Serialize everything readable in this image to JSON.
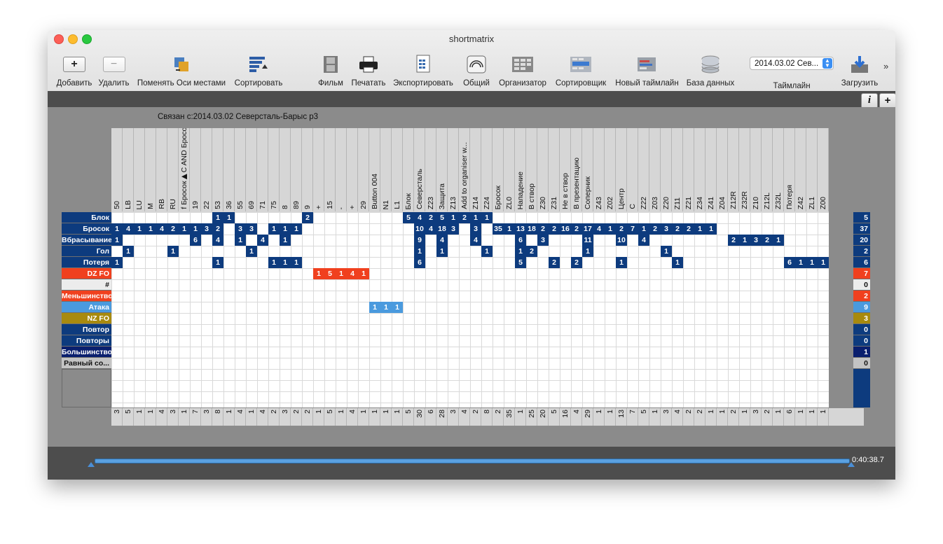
{
  "window": {
    "title": "shortmatrix"
  },
  "toolbar": {
    "add": "Добавить",
    "delete": "Удалить",
    "swap_axes": "Поменять Оси местами",
    "sort": "Сортировать",
    "film": "Фильм",
    "print": "Печатать",
    "export": "Экспортировать",
    "share": "Общий",
    "organizer": "Организатор",
    "sorter": "Сортировщик",
    "new_timeline": "Новый таймлайн",
    "database": "База данных",
    "timeline_label": "Таймлайн",
    "timeline_value": "2014.03.02 Сев...",
    "load": "Загрузить",
    "more": "»",
    "info_btn": "i",
    "plus_btn": "+"
  },
  "linked_label": "Связан с:2014.03.02 Северсталь-Барыс р3",
  "columns": [
    "50",
    "LB",
    "LU",
    "M",
    "RB",
    "RU",
    "f Бросок▶C AND Бросок",
    "19",
    "22",
    "53",
    "36",
    "55",
    "69",
    "71",
    "75",
    "8",
    "89",
    "9",
    "+",
    "15",
    "-",
    "+",
    "29",
    "Button 004",
    "N1",
    "L1",
    "Блок",
    "Северсталь",
    "Z23",
    "Защита",
    "Z13",
    "Add to organiser w...",
    "Z14",
    "Z24",
    "Бросок",
    "ZL0",
    "Нападение",
    "В створ",
    "Z30",
    "Z31",
    "Не в створ",
    "В презентацию",
    "Соперник",
    "Z43",
    "Z02",
    "Центр",
    "C",
    "Z22",
    "Z03",
    "Z20",
    "Z11",
    "Z21",
    "Z34",
    "Z41",
    "Z04",
    "Z12R",
    "Z32R",
    "Z10",
    "Z12L",
    "Z32L",
    "Потеря",
    "Z42",
    "ZL1",
    "Z00"
  ],
  "column_totals": [
    "3",
    "5",
    "1",
    "1",
    "4",
    "3",
    "1",
    "7",
    "3",
    "8",
    "1",
    "4",
    "1",
    "4",
    "2",
    "3",
    "2",
    "2",
    "1",
    "5",
    "1",
    "4",
    "1",
    "1",
    "1",
    "1",
    "5",
    "30",
    "6",
    "28",
    "3",
    "4",
    "2",
    "8",
    "2",
    "35",
    "1",
    "25",
    "20",
    "5",
    "16",
    "4",
    "29",
    "1",
    "1",
    "13",
    "7",
    "5",
    "1",
    "3",
    "4",
    "2",
    "2",
    "1",
    "1",
    "2",
    "1",
    "3",
    "2",
    "1",
    "6",
    "1",
    "1",
    "1"
  ],
  "rows": [
    {
      "label": "Блок",
      "color": "#0d3b7e",
      "total": "5",
      "total_color": "#0d3b7e",
      "cells": [
        [
          9,
          "1"
        ],
        [
          10,
          "1"
        ],
        [
          17,
          "2"
        ],
        [
          26,
          "5"
        ],
        [
          27,
          "4"
        ],
        [
          28,
          "2"
        ],
        [
          29,
          "5"
        ],
        [
          30,
          "1"
        ],
        [
          31,
          "2"
        ],
        [
          32,
          "1"
        ],
        [
          33,
          "1"
        ]
      ]
    },
    {
      "label": "Бросок",
      "color": "#0d3b7e",
      "total": "37",
      "total_color": "#0d3b7e",
      "cells": [
        [
          0,
          "1"
        ],
        [
          1,
          "4"
        ],
        [
          2,
          "1"
        ],
        [
          3,
          "1"
        ],
        [
          4,
          "4"
        ],
        [
          5,
          "2"
        ],
        [
          6,
          "1"
        ],
        [
          7,
          "1"
        ],
        [
          8,
          "3"
        ],
        [
          9,
          "2"
        ],
        [
          11,
          "3"
        ],
        [
          12,
          "3"
        ],
        [
          14,
          "1"
        ],
        [
          15,
          "1"
        ],
        [
          16,
          "1"
        ],
        [
          27,
          "10"
        ],
        [
          28,
          "4"
        ],
        [
          29,
          "18"
        ],
        [
          30,
          "3"
        ],
        [
          32,
          "3"
        ],
        [
          34,
          "35"
        ],
        [
          35,
          "1"
        ],
        [
          36,
          "13"
        ],
        [
          37,
          "18"
        ],
        [
          38,
          "2"
        ],
        [
          39,
          "2"
        ],
        [
          40,
          "16"
        ],
        [
          41,
          "2"
        ],
        [
          42,
          "17"
        ],
        [
          43,
          "4"
        ],
        [
          44,
          "1"
        ],
        [
          45,
          "2"
        ],
        [
          46,
          "7"
        ],
        [
          47,
          "1"
        ],
        [
          48,
          "2"
        ],
        [
          49,
          "3"
        ],
        [
          50,
          "2"
        ],
        [
          51,
          "2"
        ],
        [
          52,
          "1"
        ],
        [
          53,
          "1"
        ]
      ]
    },
    {
      "label": "Вбрасывание",
      "color": "#0d3b7e",
      "total": "20",
      "total_color": "#0d3b7e",
      "cells": [
        [
          0,
          "1"
        ],
        [
          7,
          "6"
        ],
        [
          9,
          "4"
        ],
        [
          11,
          "1"
        ],
        [
          13,
          "4"
        ],
        [
          15,
          "1"
        ],
        [
          27,
          "9"
        ],
        [
          29,
          "4"
        ],
        [
          32,
          "4"
        ],
        [
          36,
          "6"
        ],
        [
          38,
          "3"
        ],
        [
          42,
          "11"
        ],
        [
          45,
          "10"
        ],
        [
          47,
          "4"
        ],
        [
          55,
          "2"
        ],
        [
          56,
          "1"
        ],
        [
          57,
          "3"
        ],
        [
          58,
          "2"
        ],
        [
          59,
          "1"
        ]
      ]
    },
    {
      "label": "Гол",
      "color": "#0d3b7e",
      "total": "2",
      "total_color": "#0d3b7e",
      "cells": [
        [
          1,
          "1"
        ],
        [
          5,
          "1"
        ],
        [
          12,
          "1"
        ],
        [
          27,
          "1"
        ],
        [
          29,
          "1"
        ],
        [
          33,
          "1"
        ],
        [
          36,
          "1"
        ],
        [
          37,
          "2"
        ],
        [
          42,
          "1"
        ],
        [
          49,
          "1"
        ]
      ]
    },
    {
      "label": "Потеря",
      "color": "#0d3b7e",
      "total": "6",
      "total_color": "#0d3b7e",
      "cells": [
        [
          0,
          "1"
        ],
        [
          9,
          "1"
        ],
        [
          14,
          "1"
        ],
        [
          15,
          "1"
        ],
        [
          16,
          "1"
        ],
        [
          27,
          "6"
        ],
        [
          36,
          "5"
        ],
        [
          39,
          "2"
        ],
        [
          41,
          "2"
        ],
        [
          45,
          "1"
        ],
        [
          50,
          "1"
        ],
        [
          60,
          "6"
        ],
        [
          61,
          "1"
        ],
        [
          62,
          "1"
        ],
        [
          63,
          "1"
        ]
      ]
    },
    {
      "label": "DZ FO",
      "color": "#f0401e",
      "total": "7",
      "total_color": "#f0401e",
      "cells": [
        [
          18,
          "1"
        ],
        [
          19,
          "5"
        ],
        [
          20,
          "1"
        ],
        [
          21,
          "4"
        ],
        [
          22,
          "1"
        ]
      ]
    },
    {
      "label": "#",
      "color": "#ececec",
      "text_color": "#111111",
      "total": "0",
      "total_color": "#ececec",
      "cells": []
    },
    {
      "label": "Меньшинство",
      "color": "#f0401e",
      "total": "2",
      "total_color": "#f0401e",
      "cells": []
    },
    {
      "label": "Атака",
      "color": "#4a9ade",
      "total": "9",
      "total_color": "#4a9ade",
      "cells": [
        [
          23,
          "1"
        ],
        [
          24,
          "1"
        ],
        [
          25,
          "1"
        ]
      ]
    },
    {
      "label": "NZ FO",
      "color": "#a88a0e",
      "total": "3",
      "total_color": "#a88a0e",
      "cells": []
    },
    {
      "label": "Повтор",
      "color": "#0d3b7e",
      "total": "0",
      "total_color": "#0d3b7e",
      "cells": []
    },
    {
      "label": "Повторы",
      "color": "#0d3b7e",
      "total": "0",
      "total_color": "#0d3b7e",
      "cells": []
    },
    {
      "label": "Большинство",
      "color": "#0a1f6e",
      "total": "1",
      "total_color": "#0a1f6e",
      "cells": []
    },
    {
      "label": "Равный со...",
      "color": "#c4c4c4",
      "text_color": "#111111",
      "total": "0",
      "total_color": "#c4c4c4",
      "cells": []
    }
  ],
  "timeline": {
    "time": "0:40:38.7"
  },
  "icons": {
    "add": "plus-icon",
    "delete": "minus-icon",
    "swap": "swap-axes-icon",
    "sort": "sort-icon",
    "film": "film-icon",
    "print": "printer-icon",
    "export": "export-icon",
    "share": "share-icon",
    "organizer": "organizer-icon",
    "sorter": "sorter-icon",
    "new_timeline": "timeline-icon",
    "database": "database-icon",
    "load": "download-icon"
  }
}
